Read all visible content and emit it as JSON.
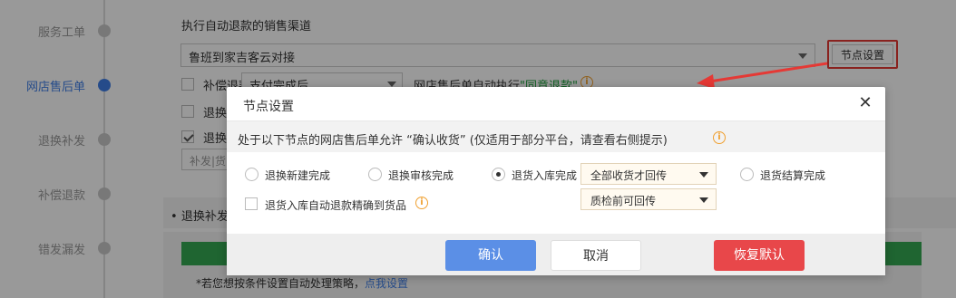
{
  "steps": [
    {
      "label": "服务工单",
      "active": false
    },
    {
      "label": "网店售后单",
      "active": true
    },
    {
      "label": "退换补发",
      "active": false
    },
    {
      "label": "补偿退款",
      "active": false
    },
    {
      "label": "错发漏发",
      "active": false
    }
  ],
  "background": {
    "channel_label": "执行自动退款的销售渠道",
    "channel_value": "鲁班到家吉客云对接",
    "node_button": "节点设置",
    "compensate_label": "补偿退款单",
    "compensate_select": "支付完成后",
    "auto_text_prefix": "网店售后单自动执行",
    "auto_text_highlight": "\"同意退款\"",
    "row2_label": "退换",
    "row3_label": "退换",
    "sub_input_placeholder": "补发|货",
    "section_title": "退换补发",
    "note_text": "*若您想按条件设置自动处理策略，",
    "note_link": "点我设置"
  },
  "dialog": {
    "title": "节点设置",
    "close_glyph": "✕",
    "info_text": "处于以下节点的网店售后单允许 “确认收货” (仅适用于部分平台，请查看右侧提示)",
    "info_icon": "i",
    "options": [
      {
        "label": "退换新建完成",
        "selected": false
      },
      {
        "label": "退换审核完成",
        "selected": false
      },
      {
        "label": "退货入库完成",
        "selected": true
      },
      {
        "label": "退货结算完成",
        "selected": false
      }
    ],
    "dropdown1": "全部收货才回传",
    "dropdown2": "质检前可回传",
    "checkbox_label": "退货入库自动退款精确到货品",
    "checkbox_checked": false,
    "buttons": {
      "ok": "确认",
      "cancel": "取消",
      "reset": "恢复默认"
    }
  },
  "colors": {
    "accent": "#3e7ee6",
    "confirm": "#5b8fe6",
    "danger": "#e8474a",
    "annotation": "#e53935",
    "success": "#34a853"
  }
}
